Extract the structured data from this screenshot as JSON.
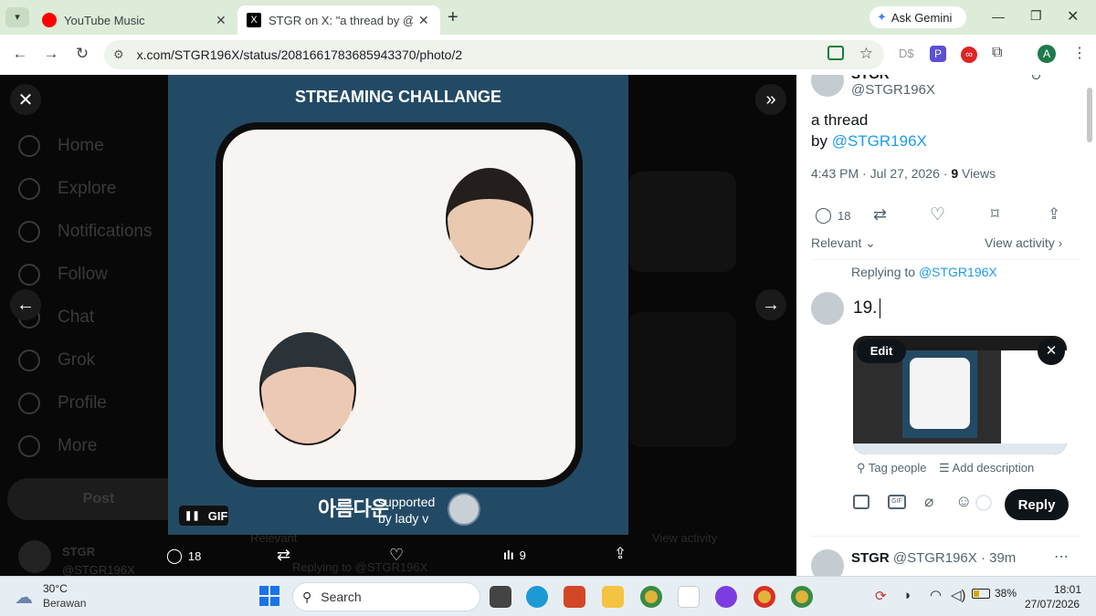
{
  "browser": {
    "tabs": [
      {
        "title": "YouTube Music",
        "active": false
      },
      {
        "title": "STGR on X: \"a thread by @STGR",
        "active": true
      }
    ],
    "new_tab": "+",
    "ask_gemini": "Ask Gemini",
    "url": "x.com/STGR196X/status/2081661783685943370/photo/2",
    "profile_initial": "A"
  },
  "left_nav": {
    "items": [
      "Home",
      "Explore",
      "Notifications",
      "Follow",
      "Chat",
      "Grok",
      "Profile",
      "More"
    ],
    "post_label": "Post",
    "account_name": "STGR",
    "account_handle": "@STGR196X"
  },
  "media": {
    "title": "STREAMING CHALLANGE",
    "footer_logo": "아름다운",
    "supported_line1": "supported",
    "supported_line2": "by lady v",
    "gif_label": "GIF",
    "counts": {
      "replies": "18",
      "views": "9"
    }
  },
  "background_feed": {
    "relevant": "Relevant",
    "view_activity": "View activity",
    "replying_to": "Replying to @STGR196X"
  },
  "tweet": {
    "author_partial": "STGR",
    "handle": "@STGR196X",
    "text_line1": "a thread",
    "text_by": "by",
    "text_mention": "@STGR196X",
    "time": "4:43 PM · Jul 27, 2026 ·",
    "views_count": "9",
    "views_label": "Views",
    "reply_count": "18",
    "sort_label": "Relevant",
    "view_activity": "View activity"
  },
  "composer": {
    "replying_label": "Replying to",
    "replying_handle": "@STGR196X",
    "text": "19.",
    "edit_label": "Edit",
    "tag_people": "Tag people",
    "add_description": "Add description",
    "reply_button": "Reply"
  },
  "next_reply": {
    "name": "STGR",
    "handle": "@STGR196X",
    "time": "· 39m"
  },
  "taskbar": {
    "weather_temp": "30°C",
    "weather_desc": "Berawan",
    "search": "Search",
    "battery": "38%",
    "time": "18:01",
    "date": "27/07/2026"
  }
}
